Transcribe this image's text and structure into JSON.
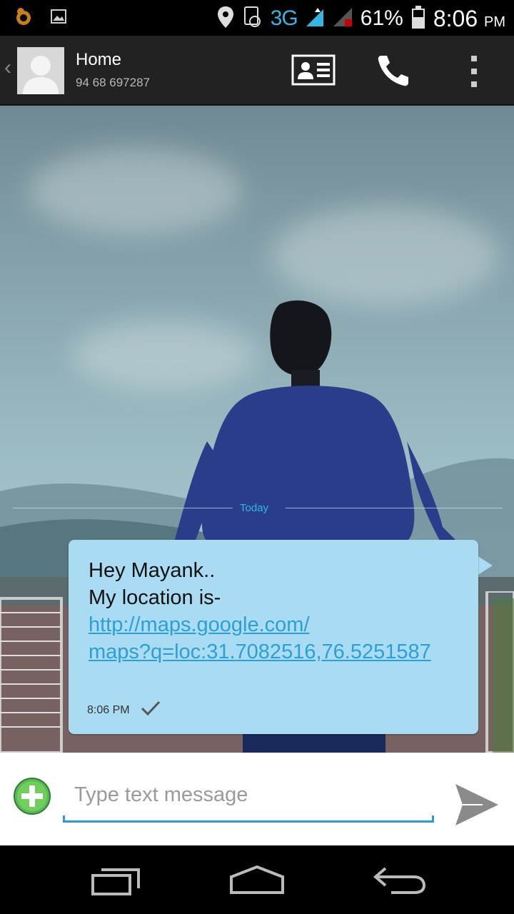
{
  "status_bar": {
    "network_type": "3G",
    "battery_percent": "61%",
    "time": "8:06",
    "time_suffix": "PM",
    "icons": [
      "uc-browser-icon",
      "image-notification-icon",
      "location-icon",
      "sim-card-icon",
      "signal-icon",
      "no-signal-icon",
      "battery-icon"
    ]
  },
  "header": {
    "contact_name": "Home",
    "contact_number": "94 68 697287",
    "actions": [
      "contact-card-icon",
      "phone-call-icon",
      "overflow-menu-icon"
    ]
  },
  "conversation": {
    "date_divider": "Today",
    "messages": [
      {
        "line1": "Hey Mayank..",
        "line2": "My location is-",
        "link_part1": "http://maps.google.com/",
        "link_part2": "maps?q=loc:31.7082516,76.5251587",
        "time": "8:06 PM",
        "status": "sent"
      }
    ]
  },
  "compose": {
    "placeholder": "Type text message",
    "value": ""
  },
  "colors": {
    "accent": "#33b5e5",
    "bubble": "#a9dcf3",
    "link": "#2c9fd3",
    "add_button": "#5cb85c"
  }
}
